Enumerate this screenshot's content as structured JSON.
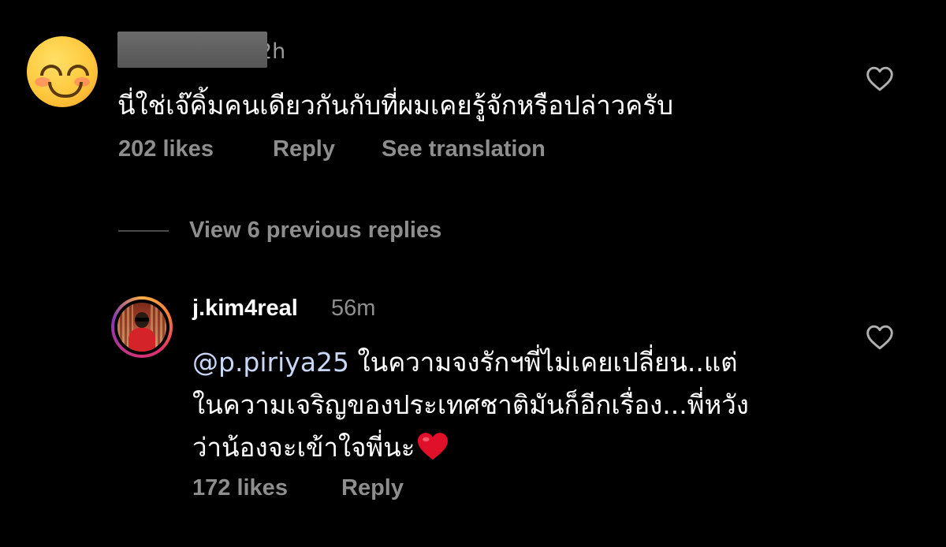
{
  "comment1": {
    "avatar_icon": "smiling-face-emoji-icon",
    "username_redacted": true,
    "time": "2h",
    "text": "นี่ใช่เจ๊คิ้มคนเดียวกันกับที่ผมเคยรู้จักหรือปล่าวครับ",
    "likes": "202 likes",
    "reply_label": "Reply",
    "translation_label": "See translation",
    "like_icon": "heart-outline-icon"
  },
  "view_replies": {
    "label": "View 6 previous replies"
  },
  "comment2": {
    "username": "j.kim4real",
    "time": "56m",
    "mention": "@p.piriya25",
    "text_line1": " ในความจงรักฯพี่ไม่เคยเปลี่ยน..แต่",
    "text_line2": "ในความเจริญของประเทศชาติมันก็อีกเรื่อง...พี่หวัง",
    "text_line3": "ว่าน้องจะเข้าใจพี่นะ",
    "emoji": "red-heart-emoji-icon",
    "likes": "172 likes",
    "reply_label": "Reply",
    "like_icon": "heart-outline-icon"
  },
  "colors": {
    "background": "#000000",
    "primary_text": "#ffffff",
    "secondary_text": "#8e8e8e",
    "mention": "#c9d6f5",
    "heart": "#e0102a"
  }
}
